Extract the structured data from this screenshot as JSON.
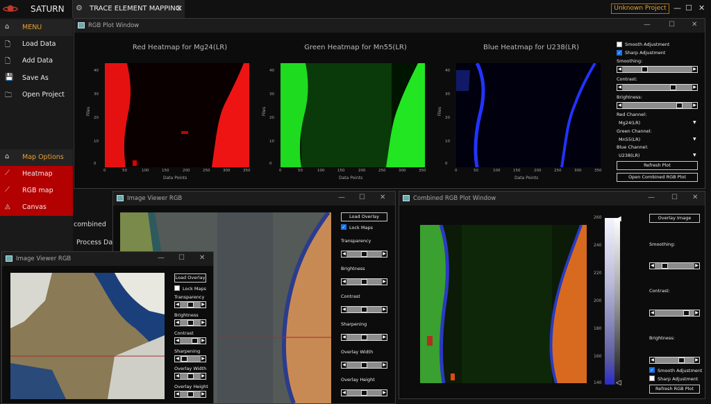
{
  "app": {
    "name": "SATURN",
    "tab_label": "TRACE ELEMENT MAPPING",
    "project": "Unknown Project"
  },
  "sidebar": {
    "menu": "MENU",
    "items": [
      {
        "label": "Load Data",
        "icon": "file-icon"
      },
      {
        "label": "Add Data",
        "icon": "add-file-icon"
      },
      {
        "label": "Save As",
        "icon": "save-icon"
      },
      {
        "label": "Open Project",
        "icon": "folder-icon"
      }
    ],
    "map_options": "Map Options",
    "map_items": [
      {
        "label": "Heatmap",
        "icon": "chart-line-icon"
      },
      {
        "label": "RGB  map",
        "icon": "chart-line-icon"
      },
      {
        "label": "Canvas",
        "icon": "chart-area-icon"
      }
    ],
    "peek_combined": "combined",
    "peek_process": "Process Data"
  },
  "rgb_window": {
    "title": "RGB Plot Window",
    "heatmaps": [
      {
        "title": "Red Heatmap for Mg24(LR)",
        "color": "#ff1a1a"
      },
      {
        "title": "Green Heatmap for Mn55(LR)",
        "color": "#22ff22"
      },
      {
        "title": "Blue Heatmap for U238(LR)",
        "color": "#2233ff"
      }
    ],
    "ylabel": "Files",
    "xlabel": "Data Points",
    "yticks": [
      "40",
      "30",
      "20",
      "10",
      "0"
    ],
    "xticks": [
      "0",
      "50",
      "100",
      "150",
      "200",
      "250",
      "300",
      "350"
    ],
    "smooth_label": "Smooth Adjustment",
    "sharp_label": "Sharp Adjustment",
    "smoothing_label": "Smoothing:",
    "contrast_label": "Contrast:",
    "brightness_label": "Brightness:",
    "smoothing_level": 0.3,
    "contrast_level": 0.75,
    "brightness_level": 0.85,
    "red_channel_label": "Red Channel:",
    "red_channel": "Mg24(LR)",
    "green_channel_label": "Green Channel:",
    "green_channel": "Mn55(LR)",
    "blue_channel_label": "Blue Channel:",
    "blue_channel": "U238(LR)",
    "refresh": "Refresh Plot",
    "open_combined": "Open Combined RGB Plot"
  },
  "viewer1": {
    "title": "Image Viewer RGB",
    "load_overlay": "Load Overlay",
    "lock_maps": "Lock Maps",
    "labels": [
      "Transparency",
      "Brightness",
      "Contrast",
      "Sharpening",
      "Overlay Width",
      "Overlay Height"
    ],
    "levels": [
      0.5,
      0.5,
      0.8,
      0.1,
      0.5,
      0.5
    ]
  },
  "viewer2": {
    "title": "Image Viewer RGB",
    "load_overlay": "Load Overlay",
    "lock_maps": "Lock Maps",
    "labels": [
      "Transparency",
      "Brightness",
      "Contrast",
      "Sharpening",
      "Overlay Width",
      "Overlay Height"
    ],
    "levels": [
      0.5,
      0.5,
      0.5,
      0.5,
      0.5,
      0.5
    ]
  },
  "combined": {
    "title": "Combined RGB Plot Window",
    "overlay_image": "Overlay Image",
    "smoothing_label": "Smoothing:",
    "contrast_label": "Contrast:",
    "brightness_label": "Brightness:",
    "smoothing_level": 0.2,
    "contrast_level": 0.85,
    "brightness_level": 0.7,
    "smooth_label": "Smooth Adjustment",
    "sharp_label": "Sharp Adjustment",
    "refresh": "Refresh RGB Plot",
    "colorbar_ticks": [
      "260",
      "240",
      "220",
      "200",
      "180",
      "160",
      "140"
    ]
  }
}
